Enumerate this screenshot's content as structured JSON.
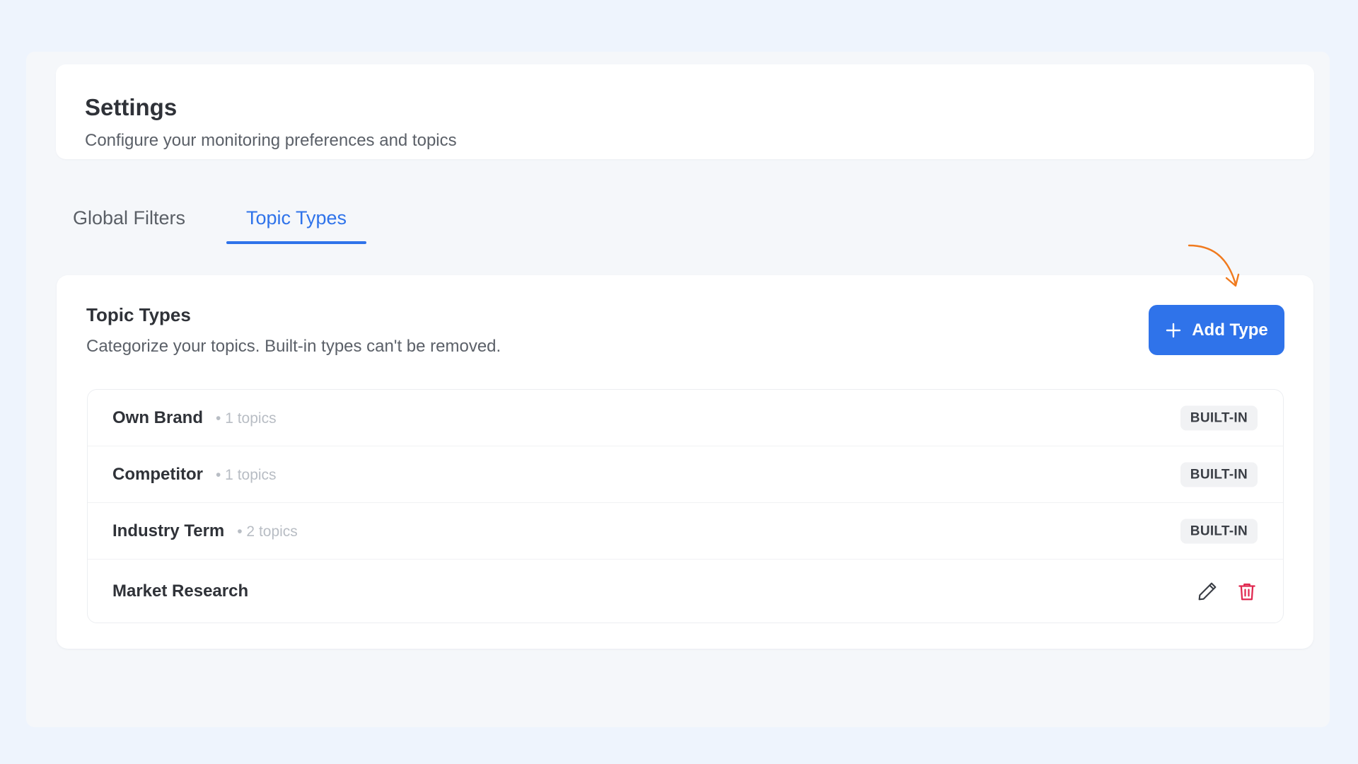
{
  "header": {
    "title": "Settings",
    "subtitle": "Configure your monitoring preferences and topics"
  },
  "tabs": [
    {
      "label": "Global Filters",
      "active": false
    },
    {
      "label": "Topic Types",
      "active": true
    }
  ],
  "section": {
    "title": "Topic Types",
    "description": "Categorize your topics. Built-in types can't be removed.",
    "add_button_label": "Add Type"
  },
  "topic_types": [
    {
      "name": "Own Brand",
      "count": "• 1 topics",
      "badge": "BUILT-IN"
    },
    {
      "name": "Competitor",
      "count": "• 1 topics",
      "badge": "BUILT-IN"
    },
    {
      "name": "Industry Term",
      "count": "• 2 topics",
      "badge": "BUILT-IN"
    },
    {
      "name": "Market Research",
      "count": null,
      "badge": null,
      "actions": [
        "pencil-icon",
        "trash-icon"
      ]
    }
  ],
  "colors": {
    "accent": "#2f73ea",
    "danger": "#e0284f",
    "annotation": "#f07a1e",
    "page_background": "#eef4fd"
  }
}
